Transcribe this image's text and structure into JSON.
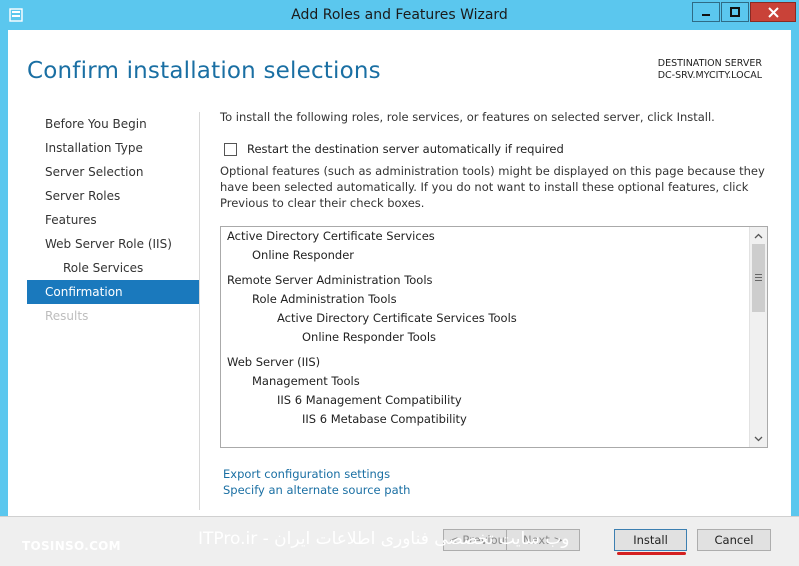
{
  "window": {
    "title": "Add Roles and Features Wizard"
  },
  "page": {
    "heading": "Confirm installation selections"
  },
  "destination": {
    "label": "DESTINATION SERVER",
    "server": "DC-SRV.MYCITY.LOCAL"
  },
  "nav": {
    "items": [
      {
        "label": "Before You Begin",
        "state": "normal",
        "sub": false
      },
      {
        "label": "Installation Type",
        "state": "normal",
        "sub": false
      },
      {
        "label": "Server Selection",
        "state": "normal",
        "sub": false
      },
      {
        "label": "Server Roles",
        "state": "normal",
        "sub": false
      },
      {
        "label": "Features",
        "state": "normal",
        "sub": false
      },
      {
        "label": "Web Server Role (IIS)",
        "state": "normal",
        "sub": false
      },
      {
        "label": "Role Services",
        "state": "normal",
        "sub": true
      },
      {
        "label": "Confirmation",
        "state": "active",
        "sub": false
      },
      {
        "label": "Results",
        "state": "disabled",
        "sub": false
      }
    ]
  },
  "main": {
    "intro": "To install the following roles, role services, or features on selected server, click Install.",
    "restart_label": "Restart the destination server automatically if required",
    "restart_checked": false,
    "optional_note": "Optional features (such as administration tools) might be displayed on this page because they have been selected automatically. If you do not want to install these optional features, click Previous to clear their check boxes."
  },
  "selections": [
    {
      "label": "Active Directory Certificate Services",
      "level": 0
    },
    {
      "label": "Online Responder",
      "level": 1
    },
    {
      "label": "Remote Server Administration Tools",
      "level": 0
    },
    {
      "label": "Role Administration Tools",
      "level": 1
    },
    {
      "label": "Active Directory Certificate Services Tools",
      "level": 2
    },
    {
      "label": "Online Responder Tools",
      "level": 3
    },
    {
      "label": "Web Server (IIS)",
      "level": 0
    },
    {
      "label": "Management Tools",
      "level": 1
    },
    {
      "label": "IIS 6 Management Compatibility",
      "level": 2
    },
    {
      "label": "IIS 6 Metabase Compatibility",
      "level": 3
    }
  ],
  "links": {
    "export": "Export configuration settings",
    "alternate_source": "Specify an alternate source path"
  },
  "footer": {
    "watermark_left": "TOSINSO.COM",
    "watermark_right": "وب سایت تخصصی فناوری اطلاعات ایران - ITPro.ir",
    "previous_label": "< Previous",
    "next_label": "Next >",
    "install_label": "Install",
    "cancel_label": "Cancel"
  },
  "colors": {
    "title_bar": "#5bc7ee",
    "accent": "#1a79bd",
    "heading": "#1a6fa3"
  }
}
